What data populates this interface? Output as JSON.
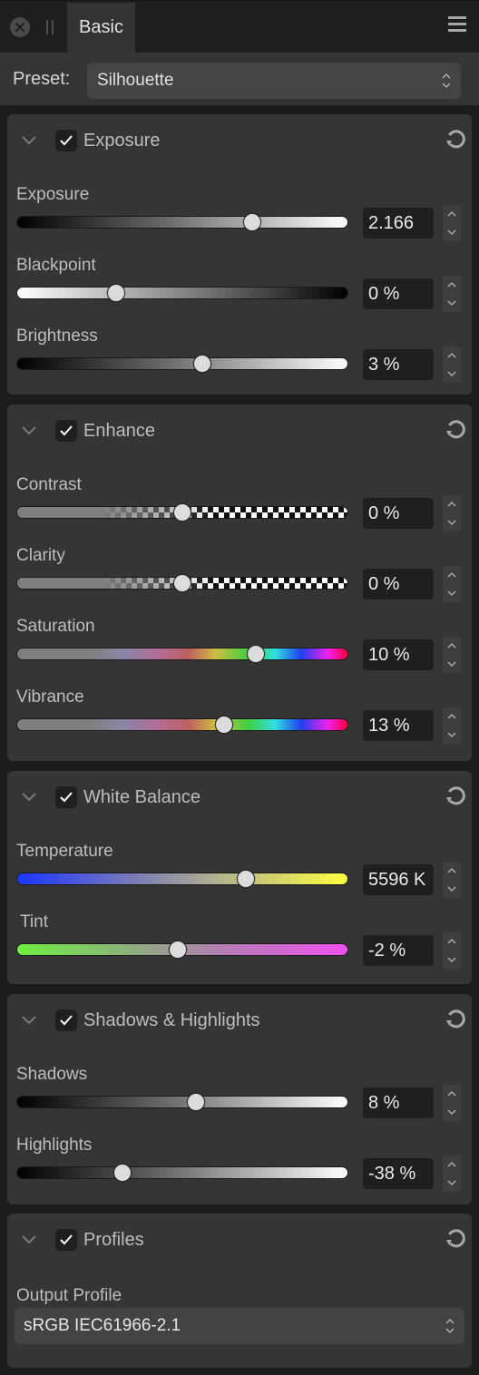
{
  "tabbar": {
    "tab_label": "Basic"
  },
  "preset": {
    "label": "Preset:",
    "value": "Silhouette"
  },
  "colors": {
    "background": "#1c1c1c",
    "panel": "#353535",
    "tab_active": "#333333",
    "value_box": "#1f1f1f",
    "knob": "#dcdcdc"
  },
  "sections": {
    "exposure": {
      "title": "Exposure",
      "enabled": true,
      "controls": [
        {
          "label": "Exposure",
          "value": "2.166",
          "position": 0.71,
          "gradient": "dark-to-light"
        },
        {
          "label": "Blackpoint",
          "value": "0 %",
          "position": 0.3,
          "gradient": "light-to-dark"
        },
        {
          "label": "Brightness",
          "value": "3 %",
          "position": 0.56,
          "gradient": "dark-to-light"
        }
      ]
    },
    "enhance": {
      "title": "Enhance",
      "enabled": true,
      "controls": [
        {
          "label": "Contrast",
          "value": "0 %",
          "position": 0.5,
          "gradient": "checker"
        },
        {
          "label": "Clarity",
          "value": "0 %",
          "position": 0.5,
          "gradient": "checker"
        },
        {
          "label": "Saturation",
          "value": "10 %",
          "position": 0.72,
          "gradient": "spectrum"
        },
        {
          "label": "Vibrance",
          "value": "13 %",
          "position": 0.625,
          "gradient": "spectrum"
        }
      ]
    },
    "white_balance": {
      "title": "White Balance",
      "enabled": true,
      "controls": [
        {
          "label": "Temperature",
          "value": "5596 K",
          "position": 0.69,
          "gradient": "blue-to-yellow"
        },
        {
          "label": "Tint",
          "value": "-2 %",
          "position": 0.485,
          "gradient": "green-to-magenta"
        }
      ]
    },
    "shadows_highlights": {
      "title": "Shadows & Highlights",
      "enabled": true,
      "controls": [
        {
          "label": "Shadows",
          "value": "8 %",
          "position": 0.54,
          "gradient": "dark-to-light"
        },
        {
          "label": "Highlights",
          "value": "-38 %",
          "position": 0.32,
          "gradient": "dark-to-light"
        }
      ]
    },
    "profiles": {
      "title": "Profiles",
      "enabled": true,
      "output_profile_label": "Output Profile",
      "output_profile_value": "sRGB IEC61966-2.1"
    }
  }
}
